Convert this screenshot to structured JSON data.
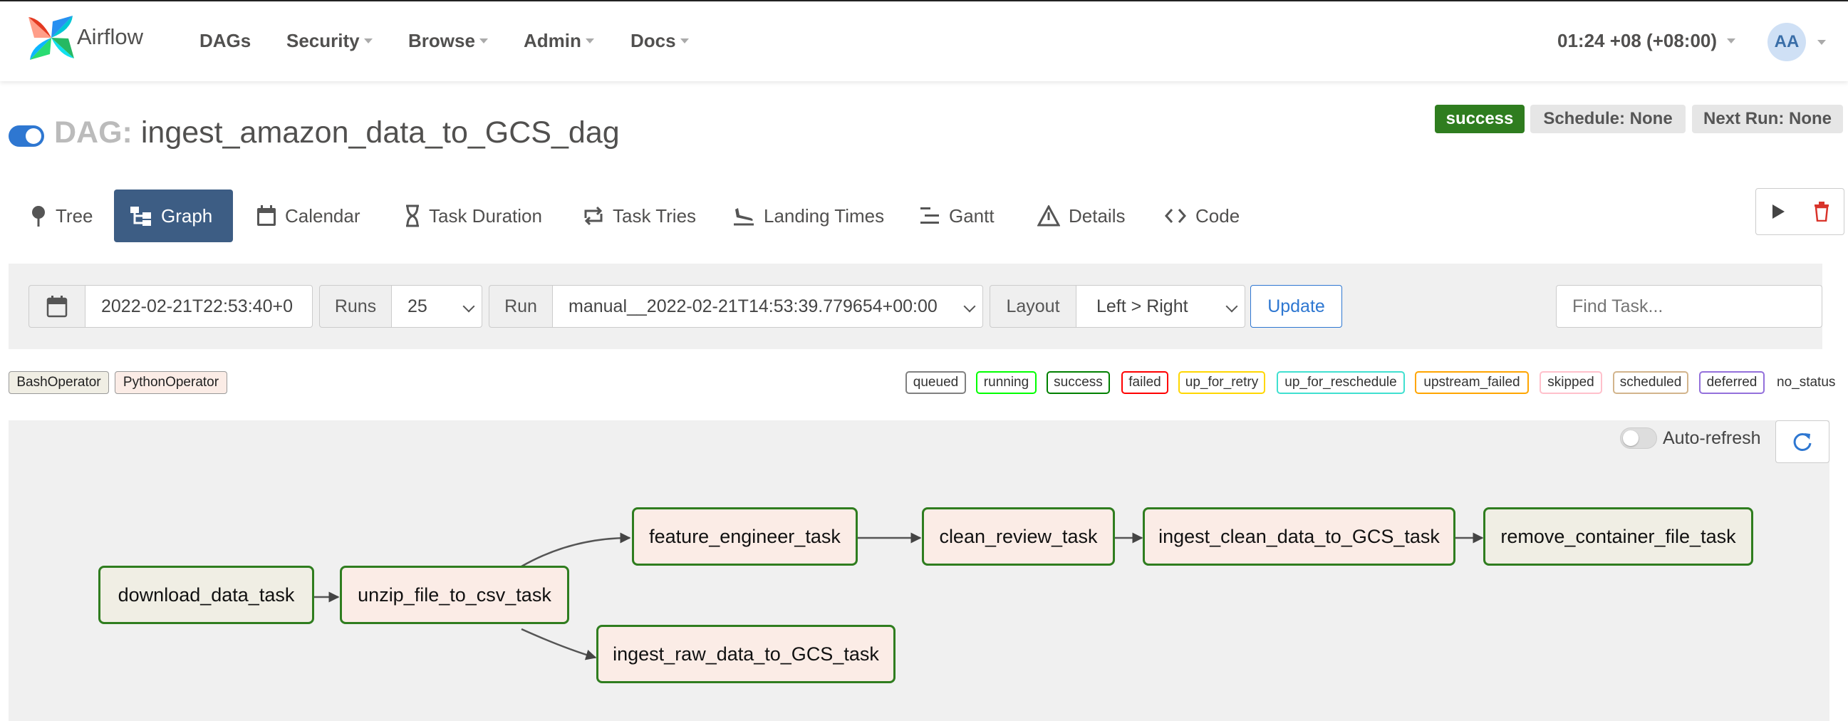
{
  "navbar": {
    "brand": "Airflow",
    "items": [
      {
        "label": "DAGs",
        "dropdown": false
      },
      {
        "label": "Security",
        "dropdown": true
      },
      {
        "label": "Browse",
        "dropdown": true
      },
      {
        "label": "Admin",
        "dropdown": true
      },
      {
        "label": "Docs",
        "dropdown": true
      }
    ],
    "clock": "01:24 +08 (+08:00)",
    "user_initials": "AA"
  },
  "dag": {
    "prefix": "DAG:",
    "name": "ingest_amazon_data_to_GCS_dag",
    "status": "success",
    "schedule": "Schedule: None",
    "next_run": "Next Run: None",
    "paused": false
  },
  "tabs": [
    "Tree",
    "Graph",
    "Calendar",
    "Task Duration",
    "Task Tries",
    "Landing Times",
    "Gantt",
    "Details",
    "Code"
  ],
  "active_tab": "Graph",
  "filters": {
    "base_date": "2022-02-21T22:53:40+0",
    "runs_label": "Runs",
    "runs_value": "25",
    "run_label": "Run",
    "run_value": "manual__2022-02-21T14:53:39.779654+00:00",
    "layout_label": "Layout",
    "layout_value": "Left > Right",
    "update_label": "Update",
    "find_placeholder": "Find Task..."
  },
  "operators": [
    "BashOperator",
    "PythonOperator"
  ],
  "states": [
    {
      "label": "queued",
      "color": "#808080"
    },
    {
      "label": "running",
      "color": "#00ff00"
    },
    {
      "label": "success",
      "color": "#008000"
    },
    {
      "label": "failed",
      "color": "#ff0000"
    },
    {
      "label": "up_for_retry",
      "color": "#ffd700"
    },
    {
      "label": "up_for_reschedule",
      "color": "#40e0d0"
    },
    {
      "label": "upstream_failed",
      "color": "#ffa500"
    },
    {
      "label": "skipped",
      "color": "#ffc0cb"
    },
    {
      "label": "scheduled",
      "color": "#d2b48c"
    },
    {
      "label": "deferred",
      "color": "#9370db"
    }
  ],
  "no_status_label": "no_status",
  "graph": {
    "auto_refresh_label": "Auto-refresh",
    "auto_refresh_on": false,
    "tasks": [
      {
        "id": "download_data_task",
        "operator": "BashOperator"
      },
      {
        "id": "unzip_file_to_csv_task",
        "operator": "PythonOperator"
      },
      {
        "id": "feature_engineer_task",
        "operator": "PythonOperator"
      },
      {
        "id": "clean_review_task",
        "operator": "PythonOperator"
      },
      {
        "id": "ingest_clean_data_to_GCS_task",
        "operator": "PythonOperator"
      },
      {
        "id": "remove_container_file_task",
        "operator": "BashOperator"
      },
      {
        "id": "ingest_raw_data_to_GCS_task",
        "operator": "PythonOperator"
      }
    ],
    "edges": [
      [
        "download_data_task",
        "unzip_file_to_csv_task"
      ],
      [
        "unzip_file_to_csv_task",
        "feature_engineer_task"
      ],
      [
        "unzip_file_to_csv_task",
        "ingest_raw_data_to_GCS_task"
      ],
      [
        "feature_engineer_task",
        "clean_review_task"
      ],
      [
        "clean_review_task",
        "ingest_clean_data_to_GCS_task"
      ],
      [
        "ingest_clean_data_to_GCS_task",
        "remove_container_file_task"
      ]
    ]
  },
  "colors": {
    "primary": "#3d5d84",
    "link": "#2e77d1",
    "success": "#2f7d1f",
    "delete": "#d9342b"
  }
}
